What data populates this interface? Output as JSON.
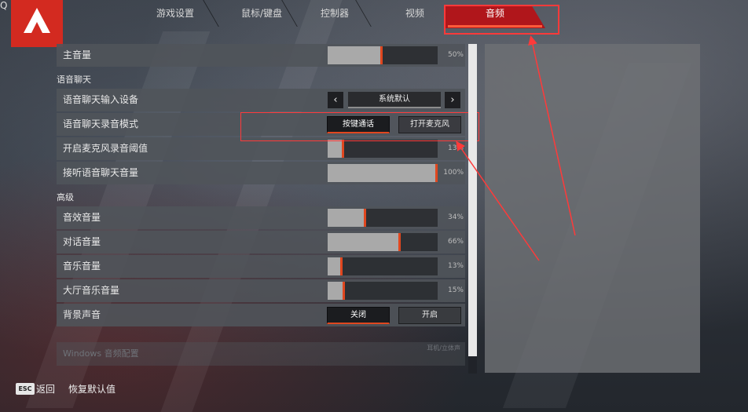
{
  "colors": {
    "accent": "#e0471f",
    "brand": "#d32a20",
    "active_tab": "#b0161b",
    "annotation": "#ff3a3a"
  },
  "corner_glyph": "Q",
  "tabs": [
    {
      "label": "游戏设置"
    },
    {
      "label": "鼠标/键盘"
    },
    {
      "label": "控制器"
    },
    {
      "label": "视频"
    },
    {
      "label": "音频",
      "active": true
    }
  ],
  "settings": {
    "master_volume": {
      "label": "主音量",
      "value_text": "50%",
      "fraction": 0.5
    },
    "voice_chat_section": "语音聊天",
    "voice_input_device": {
      "label": "语音聊天输入设备",
      "value": "系统默认",
      "prev_icon": "chevron-left-icon",
      "next_icon": "chevron-right-icon"
    },
    "voice_record_mode": {
      "label": "语音聊天录音模式",
      "options": [
        "按键通话",
        "打开麦克风"
      ],
      "selected": 0
    },
    "mic_threshold": {
      "label": "开启麦克风录音阈值",
      "value_text": "13%",
      "fraction": 0.13
    },
    "incoming_voice_volume": {
      "label": "接听语音聊天音量",
      "value_text": "100%",
      "fraction": 1.0
    },
    "advanced_section": "高级",
    "sfx_volume": {
      "label": "音效音量",
      "value_text": "34%",
      "fraction": 0.34
    },
    "dialogue_volume": {
      "label": "对话音量",
      "value_text": "66%",
      "fraction": 0.66
    },
    "music_volume": {
      "label": "音乐音量",
      "value_text": "13%",
      "fraction": 0.13
    },
    "lobby_music_volume": {
      "label": "大厅音乐音量",
      "value_text": "15%",
      "fraction": 0.15
    },
    "background_audio": {
      "label": "背景声音",
      "options": [
        "关闭",
        "开启"
      ],
      "selected": 0
    },
    "windows_audio_config": {
      "label": "Windows 音频配置",
      "value": "耳机/立体声"
    }
  },
  "footer": {
    "esc_key": "ESC",
    "back_label": "返回",
    "reset_label": "恢复默认值"
  }
}
